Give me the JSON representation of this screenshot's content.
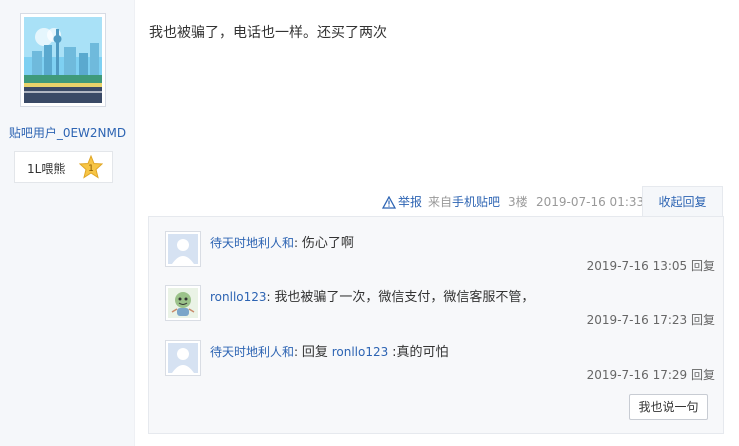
{
  "author": {
    "username": "贴吧用户_0EW2NMD",
    "level_label": "1L喂熊",
    "level_number": "1",
    "avatar_icon": "city-skyline-avatar-icon"
  },
  "post": {
    "content": "我也被骗了，电话也一样。还买了两次"
  },
  "tail": {
    "report_label": "举报",
    "source_prefix": "来自",
    "source_link": "手机贴吧",
    "floor": "3楼",
    "timestamp": "2019-07-16 01:33",
    "collapse_label": "收起回复"
  },
  "replies": [
    {
      "name": "待天时地利人和",
      "text": "伤心了啊",
      "reply_to": "",
      "time": "2019-7-16 13:05",
      "reply_label": "回复",
      "avatar_icon": "default-avatar-icon"
    },
    {
      "name": "ronllo123",
      "text": "我也被骗了一次，微信支付，微信客服不管，",
      "reply_to": "",
      "time": "2019-7-16 17:23",
      "reply_label": "回复",
      "avatar_icon": "cartoon-avatar-icon"
    },
    {
      "name": "待天时地利人和",
      "text": ":真的可怕",
      "reply_prefix": "回复",
      "reply_to": "ronllo123",
      "time": "2019-7-16 17:29",
      "reply_label": "回复",
      "avatar_icon": "default-avatar-icon"
    }
  ],
  "say_button": "我也说一句",
  "colors": {
    "link": "#2d64b3",
    "panel_bg": "#f7f8fa"
  }
}
